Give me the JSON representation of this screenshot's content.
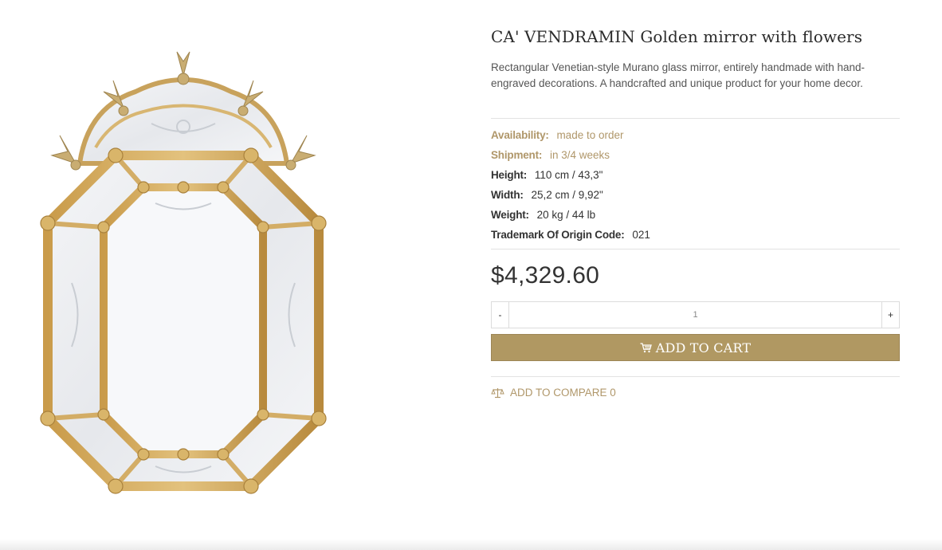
{
  "product": {
    "title": "CA' VENDRAMIN Golden mirror with flowers",
    "description": "Rectangular Venetian-style Murano glass mirror, entirely handmade with hand-engraved decorations. A handcrafted and unique product for your home decor.",
    "image_icon": "mirror-product-image"
  },
  "attributes": [
    {
      "label": "Availability:",
      "value": "made to order",
      "highlight": true
    },
    {
      "label": "Shipment:",
      "value": "in 3/4 weeks",
      "highlight": true
    },
    {
      "label": "Height:",
      "value": "110 cm / 43,3\""
    },
    {
      "label": "Width:",
      "value": "25,2 cm / 9,92\""
    },
    {
      "label": "Weight:",
      "value": "20 kg / 44 lb"
    },
    {
      "label": "Trademark Of Origin Code:",
      "value": "021"
    }
  ],
  "price": "$4,329.60",
  "quantity": {
    "minus_label": "-",
    "value": "1",
    "plus_label": "+"
  },
  "cart": {
    "label": "ADD TO CART",
    "icon": "cart-icon"
  },
  "compare": {
    "label": "ADD TO COMPARE 0",
    "icon": "scale-icon"
  },
  "colors": {
    "accent": "#b0976a",
    "button": "#b09862",
    "text": "#333333"
  }
}
